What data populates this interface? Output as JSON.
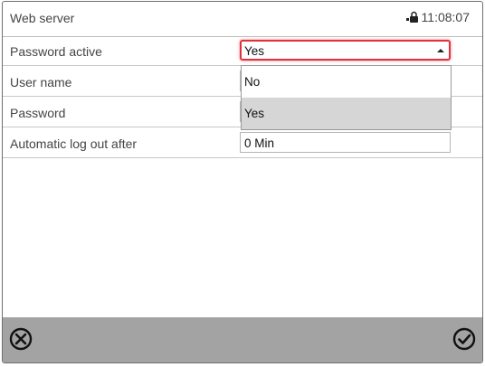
{
  "header": {
    "title": "Web server",
    "time": "11:08:07"
  },
  "rows": [
    {
      "label": "Password active",
      "value": "Yes"
    },
    {
      "label": "User name",
      "value": ""
    },
    {
      "label": "Password",
      "value": ""
    },
    {
      "label": "Automatic log out after",
      "value": "0 Min"
    }
  ],
  "dropdown": {
    "options": [
      "No",
      "Yes"
    ],
    "selected": "Yes"
  },
  "footer": {
    "cancel_icon": "close-circle-icon",
    "confirm_icon": "check-circle-icon"
  },
  "colors": {
    "focus_border": "#e0323c",
    "footer_bg": "#a3a3a3",
    "option_highlight": "#d6d6d6"
  }
}
